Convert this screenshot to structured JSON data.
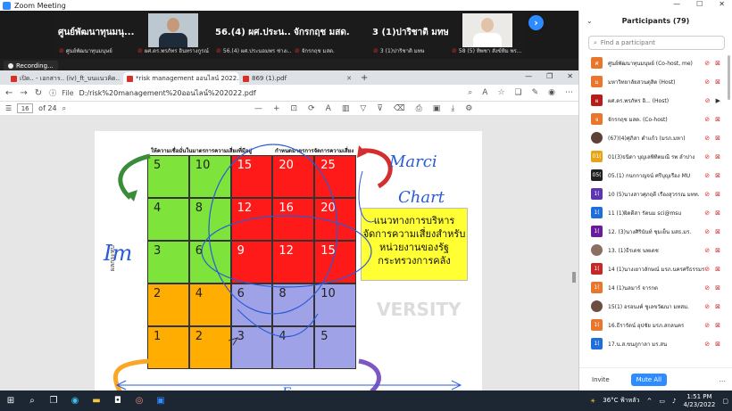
{
  "window": {
    "title": "Zoom Meeting"
  },
  "video_tiles": [
    {
      "name": "ศูนย์พัฒนาทุนมนุ...",
      "sub": "ศูนย์พัฒนาทุนมนุษย์",
      "photo": false
    },
    {
      "name": "",
      "sub": "ผศ.ดร.พรภัทร อินทรางกูรณ์",
      "photo": true
    },
    {
      "name": "56.(4) ผศ.ประน...",
      "sub": "56.(4) ผศ.ประนอมพร  ช่างเ...",
      "photo": false
    },
    {
      "name": "จักรกฤช มสด.",
      "sub": "จักรกฤช มสด.",
      "photo": false
    },
    {
      "name": "3 (1)ปาริชาติ มทษ",
      "sub": "3 (1)ปาริชาติ มทษ",
      "photo": false
    },
    {
      "name": "",
      "sub": "58 (5) ทิพชา สังข์ทิม พร...",
      "photo": true
    }
  ],
  "recording": "Recording...",
  "browser": {
    "tabs": [
      {
        "label": "เปิด.. - เอกสาร.. (iv)_ft_บนแนวคิด..",
        "active": false
      },
      {
        "label": "*risk management ออนไลน์ 2022...",
        "active": true
      },
      {
        "label": "869 (1).pdf",
        "active": false
      }
    ],
    "file_label": "File",
    "url": "D:/risk%20management%20ออนไลน์%202022.pdf",
    "page_current": "16",
    "page_total": "of 24"
  },
  "matrix": {
    "header_left": "ให้ความเชื่อมั่นในมาตรการความเสี่ยงที่มีอยู่",
    "header_right": "กำหนดมาตรการจัดการความเสี่ยง",
    "rows": [
      [
        {
          "v": "5",
          "c": "g"
        },
        {
          "v": "10",
          "c": "g"
        },
        {
          "v": "15",
          "c": "r"
        },
        {
          "v": "20",
          "c": "r"
        },
        {
          "v": "25",
          "c": "r"
        }
      ],
      [
        {
          "v": "4",
          "c": "g"
        },
        {
          "v": "8",
          "c": "g"
        },
        {
          "v": "12",
          "c": "r"
        },
        {
          "v": "16",
          "c": "r"
        },
        {
          "v": "20",
          "c": "r"
        }
      ],
      [
        {
          "v": "3",
          "c": "g"
        },
        {
          "v": "6",
          "c": "g"
        },
        {
          "v": "9",
          "c": "r"
        },
        {
          "v": "12",
          "c": "r"
        },
        {
          "v": "15",
          "c": "r"
        }
      ],
      [
        {
          "v": "2",
          "c": "o"
        },
        {
          "v": "4",
          "c": "o"
        },
        {
          "v": "6",
          "c": "p"
        },
        {
          "v": "8",
          "c": "p"
        },
        {
          "v": "10",
          "c": "p"
        }
      ],
      [
        {
          "v": "1",
          "c": "o"
        },
        {
          "v": "2",
          "c": "o"
        },
        {
          "v": "3",
          "c": "p"
        },
        {
          "v": "4",
          "c": "p"
        },
        {
          "v": "5",
          "c": "p"
        }
      ]
    ],
    "side_label": "ผลกระทบ",
    "yellow_lines": [
      "แนวทางการบริหาร",
      "จัดการความเสี่ยงสำหรับ",
      "หน่วยงานของรัฐ",
      "กระทรวงการคลัง"
    ],
    "watermark": "VERSITY",
    "handwriting": [
      "Im",
      "Marci",
      "Chart",
      "E"
    ]
  },
  "panel": {
    "title": "Participants (79)",
    "search_placeholder": "Find a participant",
    "participants": [
      {
        "initial": "ศ",
        "color": "#e8762d",
        "name": "ศูนย์พัฒนาทุนมนุษย์ (Co-host, me)",
        "cam_on": false,
        "photo": false
      },
      {
        "initial": "ม",
        "color": "#e8762d",
        "name": "มหาวิทยาลัยสวนดุสิต (Host)",
        "cam_on": false,
        "photo": false
      },
      {
        "initial": "ผ",
        "color": "#b71c1c",
        "name": "ผศ.ดร.พรภัทร อิ... (Host)",
        "cam_on": true,
        "photo": false
      },
      {
        "initial": "จ",
        "color": "#e8762d",
        "name": "จักรกฤช มสด. (Co-host)",
        "cam_on": false,
        "photo": false
      },
      {
        "initial": "",
        "color": "#5d4037",
        "name": "(67)(4)ศุภิสา ตำแก้ว (มรภ.มหา)",
        "cam_on": false,
        "photo": true
      },
      {
        "initial": "01(",
        "color": "#e8a317",
        "name": "01(3)ธนิดา บุญเลพิทิตมณี รพ ลำปาง",
        "cam_on": false,
        "photo": false
      },
      {
        "initial": "05(",
        "color": "#212121",
        "name": "05.(1) กนกกาญจน์ ศรีบุญเรือง MU",
        "cam_on": false,
        "photo": false
      },
      {
        "initial": "1(",
        "color": "#5e35b1",
        "name": "10 (5)นางสาวศุภฤดี เรืองสุวรรณ มทท.",
        "cam_on": false,
        "photo": false
      },
      {
        "initial": "1(",
        "color": "#1e6fd9",
        "name": "11 (1)ผิดดีสา รัตนม sci@msu",
        "cam_on": false,
        "photo": false
      },
      {
        "initial": "1(",
        "color": "#6a1b9a",
        "name": "12. (3)นางศิรินันท์ ชุมเย็น มสธ.มร.",
        "cam_on": false,
        "photo": false
      },
      {
        "initial": "",
        "color": "#8d6e63",
        "name": "13. (1)ธีรเดช นพเดช",
        "cam_on": false,
        "photo": true
      },
      {
        "initial": "1(",
        "color": "#c62828",
        "name": "14 (1)นางเยาวลักษณ์ มรภ.นครศรีธรรมราช",
        "cam_on": false,
        "photo": false
      },
      {
        "initial": "1(",
        "color": "#e8762d",
        "name": "14 (1)นลมาร์ จารกต",
        "cam_on": false,
        "photo": false
      },
      {
        "initial": "",
        "color": "#6d4c41",
        "name": "15(1) อรอนงค์ ชูเลขวัฒนา มทสม.",
        "cam_on": false,
        "photo": true
      },
      {
        "initial": "1(",
        "color": "#e8762d",
        "name": "16.ธีรารัตน์ อุปชัย มรภ.สกลนคร",
        "cam_on": false,
        "photo": false
      },
      {
        "initial": "1(",
        "color": "#1e6fd9",
        "name": "17.น.ส.ขนภูกาลา มร.สน",
        "cam_on": false,
        "photo": false
      }
    ],
    "invite": "Invite",
    "mute_all": "Mute All",
    "more": "..."
  },
  "taskbar": {
    "weather": "36°C ฟ้าหลัว",
    "time": "1:51 PM",
    "date": "4/23/2022"
  }
}
